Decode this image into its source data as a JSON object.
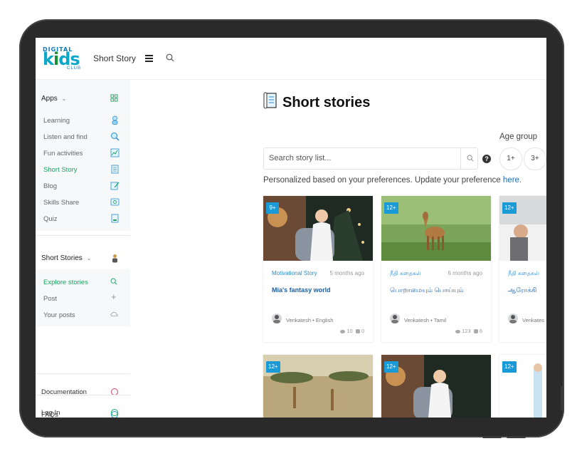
{
  "header": {
    "logo": {
      "line1": "DIGITAL",
      "line2a": "k",
      "line2b": "i",
      "line2c": "ds",
      "line3": "CLUB"
    },
    "title": "Short Story"
  },
  "sidebar": {
    "apps": {
      "label": "Apps",
      "items": [
        {
          "label": "Learning",
          "icon": "student-icon"
        },
        {
          "label": "Listen and find",
          "icon": "search-magnify-icon"
        },
        {
          "label": "Fun activities",
          "icon": "activity-icon"
        },
        {
          "label": "Short Story",
          "icon": "story-scroll-icon",
          "active": true
        },
        {
          "label": "Blog",
          "icon": "blog-edit-icon"
        },
        {
          "label": "Skills Share",
          "icon": "skills-share-icon"
        },
        {
          "label": "Quiz",
          "icon": "quiz-icon"
        }
      ]
    },
    "short_stories": {
      "label": "Short Stories",
      "items": [
        {
          "label": "Explore stories",
          "active": true
        },
        {
          "label": "Post"
        },
        {
          "label": "Your posts"
        }
      ]
    },
    "bottom": [
      {
        "label": "Documentation",
        "color": "#e0405a"
      },
      {
        "label": "FAQs",
        "color": "#1a9bd7"
      },
      {
        "label": "Log In",
        "color": "#17a561"
      }
    ]
  },
  "main": {
    "title": "Short stories",
    "search_placeholder": "Search story list...",
    "age_group_label": "Age group",
    "age_chips": [
      "1+",
      "3+"
    ],
    "preference_text": "Personalized based on your preferences. Update your preference",
    "preference_link": "here.",
    "cards": [
      {
        "badge": "9+",
        "category": "Motivational Story",
        "time": "5 months ago",
        "title": "Mia's fantasy world",
        "author": "Venkatesh",
        "language": "English",
        "views": "10",
        "comments": "0"
      },
      {
        "badge": "12+",
        "category": "நீதி கதைகள்",
        "time": "6 months ago",
        "title": "பொறாமையும் பொய்யும்",
        "author": "Venkatesh",
        "language": "Tamil",
        "views": "123",
        "comments": "6"
      },
      {
        "badge": "12+",
        "category": "நீதி கதைகள்",
        "time": "",
        "title": "ஆரோக்கி",
        "author": "Venkates",
        "language": "",
        "views": "",
        "comments": ""
      }
    ],
    "cards_row2": [
      {
        "badge": "12+"
      },
      {
        "badge": "12+"
      },
      {
        "badge": "12+"
      }
    ]
  },
  "colors": {
    "accent_green": "#17a561",
    "accent_blue": "#1a9bd7",
    "link_blue": "#1c6fb8"
  }
}
